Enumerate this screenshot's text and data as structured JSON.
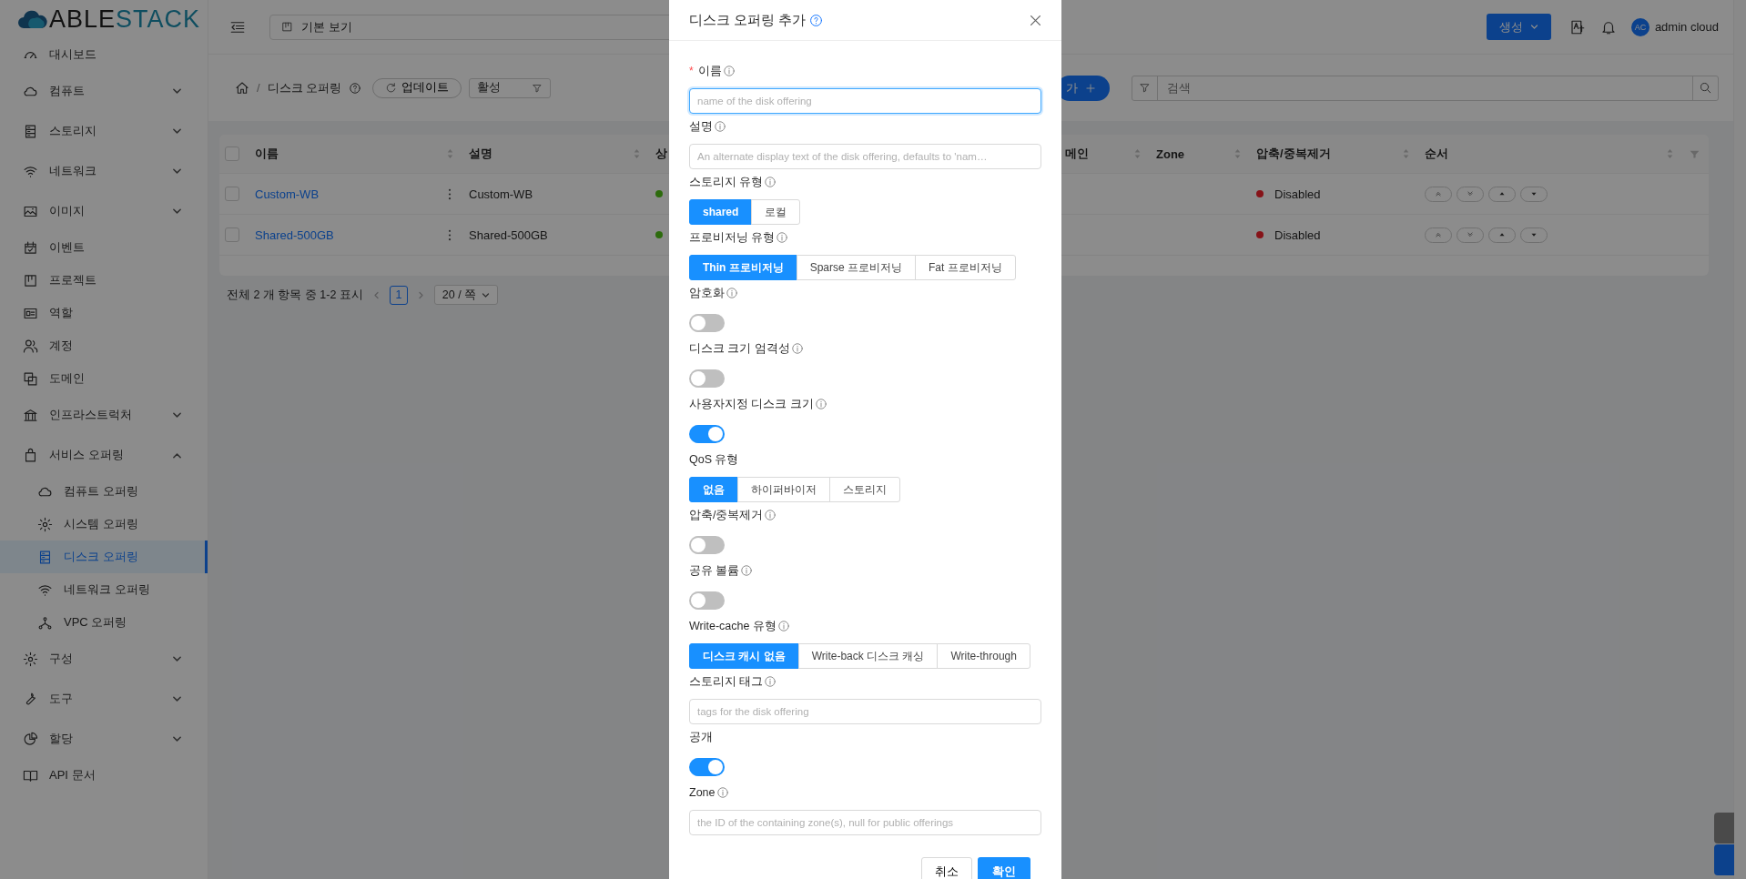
{
  "logo": {
    "primary": "ABLE",
    "secondary": "STACK"
  },
  "sidebar": {
    "items": [
      {
        "label": "대시보드",
        "selected": false
      },
      {
        "label": "컴퓨트",
        "expanded": false,
        "selected": false
      },
      {
        "label": "스토리지",
        "expanded": false,
        "selected": false
      },
      {
        "label": "네트워크",
        "expanded": false,
        "selected": false
      },
      {
        "label": "이미지",
        "expanded": false,
        "selected": false
      },
      {
        "label": "이벤트",
        "selected": false
      },
      {
        "label": "프로젝트",
        "selected": false
      },
      {
        "label": "역할",
        "selected": false
      },
      {
        "label": "계정",
        "selected": false
      },
      {
        "label": "도메인",
        "selected": false
      },
      {
        "label": "인프라스트럭처",
        "expanded": false,
        "selected": false
      },
      {
        "label": "서비스 오퍼링",
        "expanded": true,
        "selected": false,
        "children": [
          {
            "label": "컴퓨트 오퍼링",
            "selected": false
          },
          {
            "label": "시스템 오퍼링",
            "selected": false
          },
          {
            "label": "디스크 오퍼링",
            "selected": true
          },
          {
            "label": "네트워크 오퍼링",
            "selected": false
          },
          {
            "label": "VPC 오퍼링",
            "selected": false
          }
        ]
      },
      {
        "label": "구성",
        "expanded": false,
        "selected": false
      },
      {
        "label": "도구",
        "expanded": false,
        "selected": false
      },
      {
        "label": "할당",
        "expanded": false,
        "selected": false
      },
      {
        "label": "API 문서",
        "selected": false
      }
    ]
  },
  "header": {
    "view_selector": "기본 보기",
    "create_button": "생성",
    "avatar": "AC",
    "user": "admin cloud"
  },
  "toolbar": {
    "separator": "/",
    "breadcrumb": "디스크 오퍼링",
    "refresh_button": "업데이트",
    "filter_select": "활성",
    "add_button": "가",
    "search": {
      "placeholder": "검색"
    }
  },
  "table": {
    "all_checked": false,
    "columns": [
      "이름",
      "설명",
      "상",
      "메인",
      "Zone",
      "압축/중복제거",
      "순서"
    ],
    "rows": [
      {
        "checked": false,
        "name": "Custom-WB",
        "description": "Custom-WB",
        "status": {
          "color": "#2d6c0e"
        },
        "compression": {
          "label": "Disabled",
          "color": "#871319"
        }
      },
      {
        "checked": false,
        "name": "Shared-500GB",
        "description": "Shared-500GB",
        "status": {
          "color": "#2d6c0e"
        },
        "compression": {
          "label": "Disabled",
          "color": "#871319"
        }
      }
    ]
  },
  "pagination": {
    "summary": "전체 2 개 항목 중 1-2 표시",
    "pages": [
      {
        "label": "1",
        "selected": true
      }
    ],
    "page_size": "20 / 쪽"
  },
  "modal": {
    "title": "디스크 오퍼링 추가",
    "fields": [
      {
        "kind": "input",
        "required_mark": "*",
        "label": "이름",
        "info": true,
        "placeholder": "name of the disk offering",
        "focused": true
      },
      {
        "kind": "input",
        "label": "설명",
        "info": true,
        "placeholder": "An alternate display text of the disk offering, defaults to 'nam…",
        "focused": false
      },
      {
        "kind": "segmented",
        "label": "스토리지 유형",
        "info": true,
        "options": [
          {
            "label": "shared",
            "selected": true
          },
          {
            "label": "로컬",
            "selected": false
          }
        ]
      },
      {
        "kind": "segmented",
        "label": "프로비저닝 유형",
        "info": true,
        "options": [
          {
            "label": "Thin 프로비저닝",
            "selected": true
          },
          {
            "label": "Sparse 프로비저닝",
            "selected": false
          },
          {
            "label": "Fat 프로비저닝",
            "selected": false
          }
        ]
      },
      {
        "kind": "switch",
        "label": "암호화",
        "info": true,
        "on": false
      },
      {
        "kind": "switch",
        "label": "디스크 크기 엄격성",
        "info": true,
        "on": false
      },
      {
        "kind": "switch",
        "label": "사용자지정 디스크 크기",
        "info": true,
        "on": true
      },
      {
        "kind": "segmented",
        "label": "QoS 유형",
        "info": false,
        "options": [
          {
            "label": "없음",
            "selected": true
          },
          {
            "label": "하이퍼바이저",
            "selected": false
          },
          {
            "label": "스토리지",
            "selected": false
          }
        ]
      },
      {
        "kind": "switch",
        "label": "압축/중복제거",
        "info": true,
        "on": false
      },
      {
        "kind": "switch",
        "label": "공유 볼륨",
        "info": true,
        "on": false
      },
      {
        "kind": "segmented",
        "label": "Write-cache 유형",
        "info": true,
        "options": [
          {
            "label": "디스크 캐시 없음",
            "selected": true
          },
          {
            "label": "Write-back 디스크 캐싱",
            "selected": false
          },
          {
            "label": "Write-through",
            "selected": false
          }
        ]
      },
      {
        "kind": "input",
        "label": "스토리지 태그",
        "info": true,
        "placeholder": "tags for the disk offering",
        "focused": false
      },
      {
        "kind": "switch",
        "label": "공개",
        "info": false,
        "on": true
      },
      {
        "kind": "input",
        "label": "Zone",
        "info": true,
        "placeholder": "the ID of the containing zone(s), null for public offerings",
        "focused": false
      }
    ],
    "cancel_button": "취소",
    "ok_button": "확인"
  }
}
